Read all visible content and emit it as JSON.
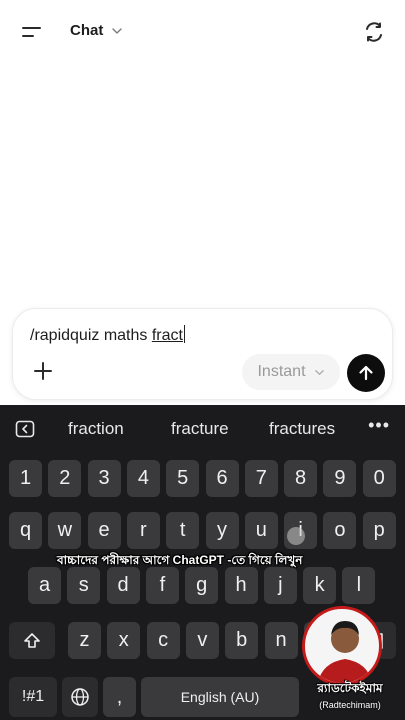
{
  "header": {
    "title": "Chat",
    "menu_icon": "menu-icon",
    "new_chat_icon": "new-chat-icon"
  },
  "composer": {
    "text_prefix": "/rapidquiz maths ",
    "text_underlined": "fract",
    "model_label": "Instant",
    "plus_icon": "plus-icon",
    "send_icon": "arrow-up-icon"
  },
  "keyboard": {
    "suggestions": [
      "fraction",
      "fracture",
      "fractures"
    ],
    "number_row": [
      "1",
      "2",
      "3",
      "4",
      "5",
      "6",
      "7",
      "8",
      "9",
      "0"
    ],
    "row1": [
      "q",
      "w",
      "e",
      "r",
      "t",
      "y",
      "u",
      "i",
      "o",
      "p"
    ],
    "row2": [
      "a",
      "s",
      "d",
      "f",
      "g",
      "h",
      "j",
      "k",
      "l"
    ],
    "row3": [
      "z",
      "x",
      "c",
      "v",
      "b",
      "n",
      "m"
    ],
    "symbols_label": "!#1",
    "space_label": "English (AU)",
    "comma_label": ","
  },
  "overlay": {
    "caption": "বাচ্চাদের পরীক্ষার আগে ChatGPT -তে গিয়ে লিখুন",
    "watermark_main": "র‍্যাডটেকইমাম",
    "watermark_sub": "(Radtechimam)"
  },
  "colors": {
    "keyboard_bg": "#1b1b1d",
    "key": "#3a3a3c",
    "send": "#0d0d0d",
    "brand_ring": "#c51a1a"
  }
}
